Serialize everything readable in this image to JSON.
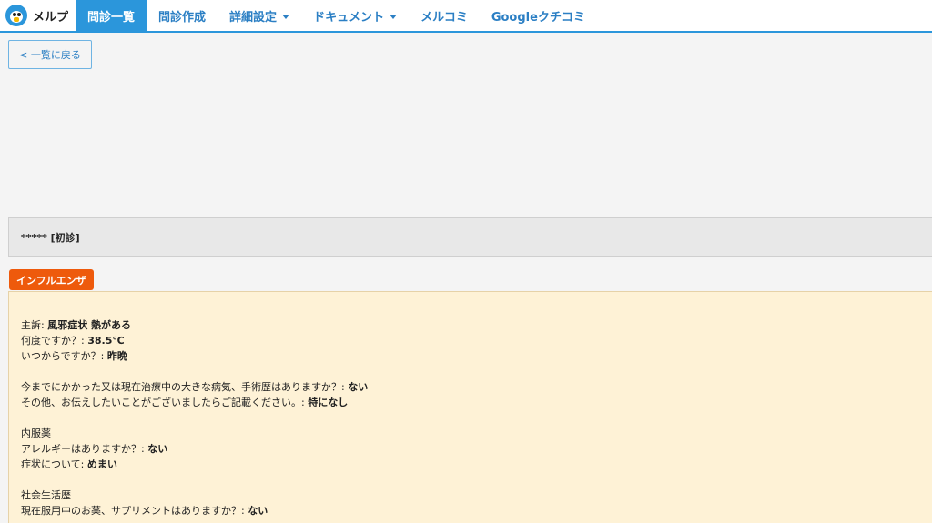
{
  "brand": {
    "name": "メルプ"
  },
  "nav": {
    "items": [
      {
        "label": "問診一覧",
        "active": true,
        "dropdown": false
      },
      {
        "label": "問診作成",
        "active": false,
        "dropdown": false
      },
      {
        "label": "詳細設定",
        "active": false,
        "dropdown": true
      },
      {
        "label": "ドキュメント",
        "active": false,
        "dropdown": true
      },
      {
        "label": "メルコミ",
        "active": false,
        "dropdown": false
      },
      {
        "label": "Googleクチコミ",
        "active": false,
        "dropdown": false
      }
    ]
  },
  "back_button": {
    "label": "< 一覧に戻る"
  },
  "patient": {
    "header": "***** [初診]"
  },
  "tag": {
    "label": "インフルエンザ",
    "color": "#ee5a0c"
  },
  "answers": {
    "group1": [
      {
        "q": "主訴: ",
        "a": "風邪症状 熱がある"
      },
      {
        "q": "何度ですか？: ",
        "a": "38.5℃"
      },
      {
        "q": "いつからですか？: ",
        "a": "昨晩"
      }
    ],
    "group2": [
      {
        "q": "今までにかかった又は現在治療中の大きな病気、手術歴はありますか？: ",
        "a": "ない"
      },
      {
        "q": "その他、お伝えしたいことがございましたらご記載ください。: ",
        "a": "特になし"
      }
    ],
    "group3": [
      {
        "q": "内服薬",
        "a": ""
      },
      {
        "q": "アレルギーはありますか？: ",
        "a": "ない"
      },
      {
        "q": "症状について: ",
        "a": "めまい"
      }
    ],
    "group4": [
      {
        "q": "社会生活歴",
        "a": ""
      },
      {
        "q": "現在服用中のお薬、サプリメントはありますか？: ",
        "a": "ない"
      }
    ]
  },
  "colors": {
    "accent": "#2b96db",
    "link": "#2b7fc4",
    "answer_bg": "#fef2d6"
  }
}
